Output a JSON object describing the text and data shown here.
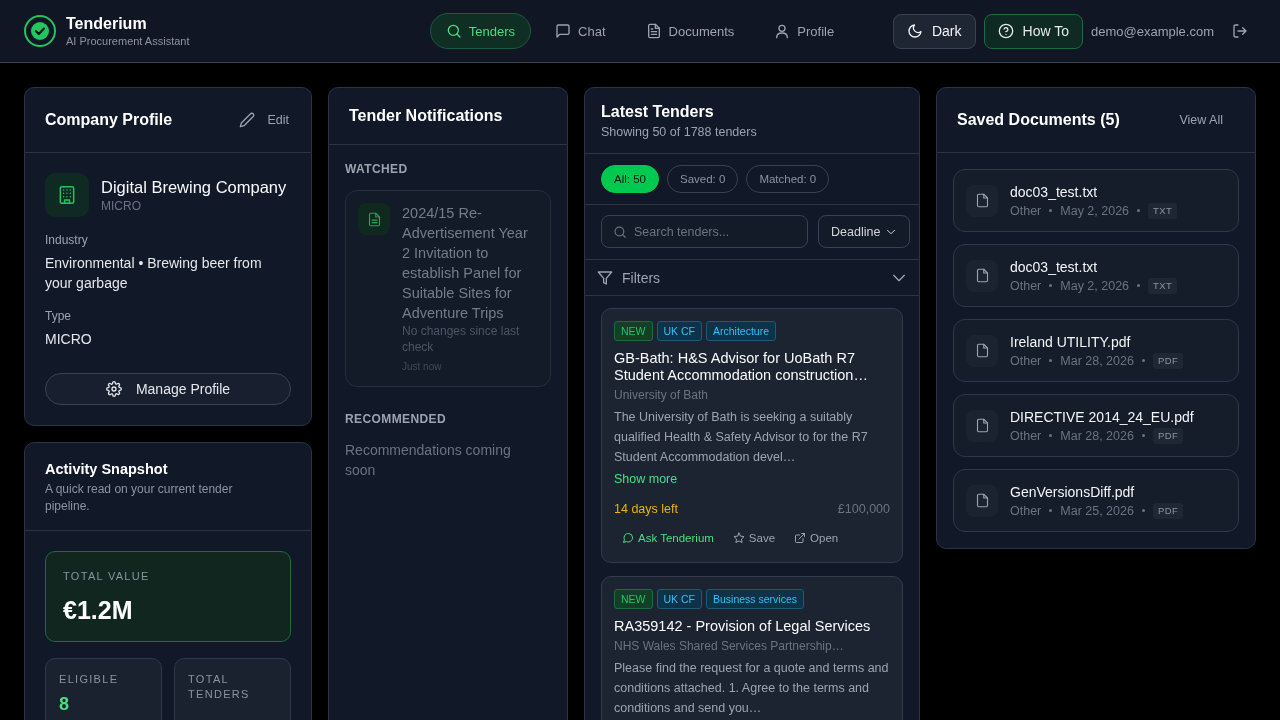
{
  "header": {
    "app_name": "Tenderium",
    "tagline": "AI Procurement Assistant",
    "nav": [
      {
        "label": "Tenders",
        "selected": true
      },
      {
        "label": "Chat",
        "selected": false
      },
      {
        "label": "Documents",
        "selected": false
      },
      {
        "label": "Profile",
        "selected": false
      }
    ],
    "theme_button": "Dark",
    "help_button": "How To",
    "user_email": "demo@example.com"
  },
  "company_profile": {
    "title": "Company Profile",
    "edit_button": "Edit",
    "company_name": "Digital Brewing Company",
    "company_size": "MICRO",
    "fields": [
      {
        "label": "Industry",
        "value": "Environmental • Brewing beer from your garbage"
      },
      {
        "label": "Type",
        "value": "MICRO"
      }
    ],
    "manage_button": "Manage Profile"
  },
  "activity_snapshot": {
    "title": "Activity Snapshot",
    "subtitle": "A quick read on your current tender pipeline.",
    "highlight": {
      "label": "TOTAL VALUE",
      "value": "€1.2M"
    },
    "stats": [
      {
        "label": "ELIGIBLE",
        "value": "8"
      },
      {
        "label": "TOTAL TENDERS"
      }
    ]
  },
  "tender_notifications": {
    "title": "Tender Notifications",
    "watched_label": "WATCHED",
    "watched": [
      {
        "title": "2024/15 Re-Advertisement Year 2 Invitation to establish Panel for Suitable Sites for Adventure Trips",
        "status": "No changes since last check",
        "time": "Just now"
      }
    ],
    "recommended_label": "RECOMMENDED",
    "recommended_empty": "Recommendations coming soon"
  },
  "latest_tenders": {
    "title": "Latest Tenders",
    "subtitle": "Showing 50 of 1788 tenders",
    "filters": [
      {
        "label": "All: 50",
        "selected": true
      },
      {
        "label": "Saved: 0",
        "selected": false
      },
      {
        "label": "Matched: 0",
        "selected": false
      }
    ],
    "search": {
      "placeholder": "Search tenders..."
    },
    "sort": "Deadline",
    "filters_panel": {
      "label": "Filters",
      "expanded": false
    },
    "tenders": [
      {
        "tags": [
          {
            "label": "NEW",
            "kind": "new"
          },
          {
            "label": "UK CF",
            "kind": "source"
          },
          {
            "label": "Architecture",
            "kind": "category"
          }
        ],
        "title": "GB-Bath: H&S Advisor for UoBath R7 Student Accommodation construction…",
        "organisation": "University of Bath",
        "description": "The University of Bath is seeking a suitably qualified Health & Safety Advisor to for the R7 Student Accommodation devel…",
        "show_more": "Show more",
        "deadline": "14 days left",
        "value": "£100,000",
        "actions": [
          {
            "label": "Ask Tenderium",
            "kind": "ask"
          },
          {
            "label": "Save",
            "kind": "save"
          },
          {
            "label": "Open",
            "kind": "open"
          }
        ]
      },
      {
        "tags": [
          {
            "label": "NEW",
            "kind": "new"
          },
          {
            "label": "UK CF",
            "kind": "source"
          },
          {
            "label": "Business services",
            "kind": "category"
          }
        ],
        "title": "RA359142 - Provision of Legal Services",
        "organisation": "NHS Wales Shared Services Partnership…",
        "description": "Please find the request for a quote and terms and conditions attached. 1. Agree to the terms and conditions and send you…"
      }
    ]
  },
  "saved_documents": {
    "title": "Saved Documents (5)",
    "view_all": "View All",
    "documents": [
      {
        "name": "doc03_test.txt",
        "category": "Other",
        "date": "May 2, 2026",
        "type": "TXT"
      },
      {
        "name": "doc03_test.txt",
        "category": "Other",
        "date": "May 2, 2026",
        "type": "TXT"
      },
      {
        "name": "Ireland UTILITY.pdf",
        "category": "Other",
        "date": "Mar 28, 2026",
        "type": "PDF"
      },
      {
        "name": "DIRECTIVE 2014_24_EU.pdf",
        "category": "Other",
        "date": "Mar 28, 2026",
        "type": "PDF"
      },
      {
        "name": "GenVersionsDiff.pdf",
        "category": "Other",
        "date": "Mar 25, 2026",
        "type": "PDF"
      }
    ]
  }
}
